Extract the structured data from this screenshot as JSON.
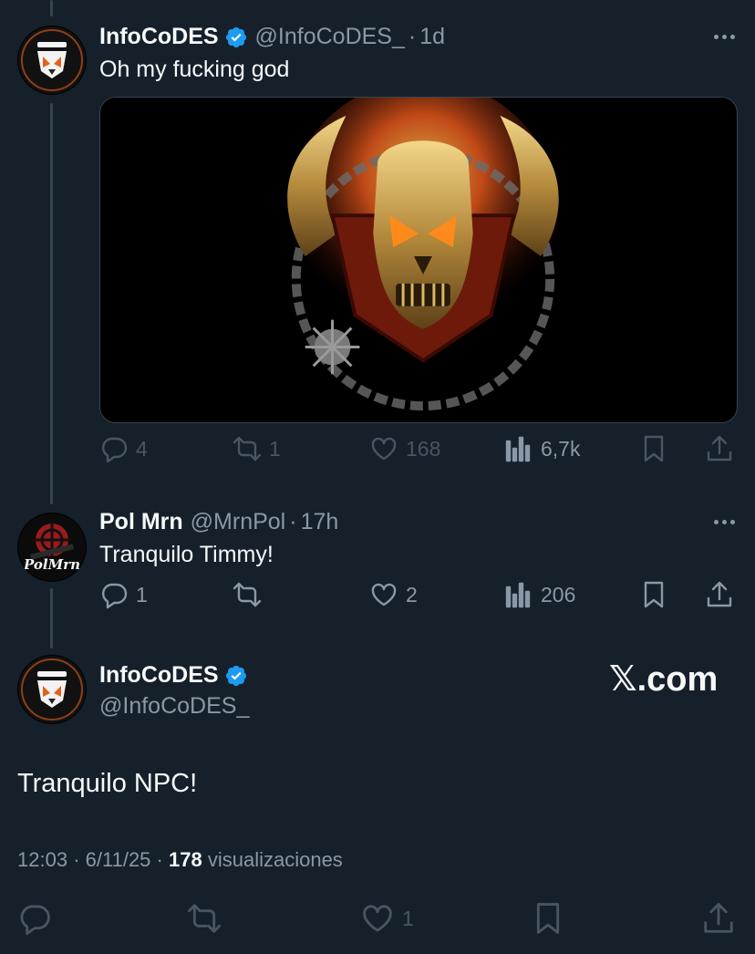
{
  "tweets": [
    {
      "name": "InfoCoDES",
      "handle": "@InfoCoDES_",
      "time": "1d",
      "text": "Oh my fucking god",
      "avatar_label": "INFOCODES",
      "stats": {
        "replies": "4",
        "retweets": "1",
        "likes": "168",
        "views": "6,7k"
      }
    },
    {
      "name": "Pol Mrn",
      "handle": "@MrnPol",
      "time": "17h",
      "text": "Tranquilo Timmy!",
      "avatar_label": "PolMrn",
      "stats": {
        "replies": "1",
        "retweets": "",
        "likes": "2",
        "views": "206"
      }
    }
  ],
  "main_tweet": {
    "name": "InfoCoDES",
    "handle": "@InfoCoDES_",
    "avatar_label": "INFOCODES",
    "text": "Tranquilo NPC!",
    "time": "12:03",
    "date": "6/11/25",
    "views_count": "178",
    "views_label": "visualizaciones",
    "likes": "1"
  },
  "watermark": "𝕏.com",
  "colors": {
    "background": "#15202b",
    "verified": "#1d9bf0",
    "text": "#f7f9f9",
    "muted": "#8b98a5"
  }
}
